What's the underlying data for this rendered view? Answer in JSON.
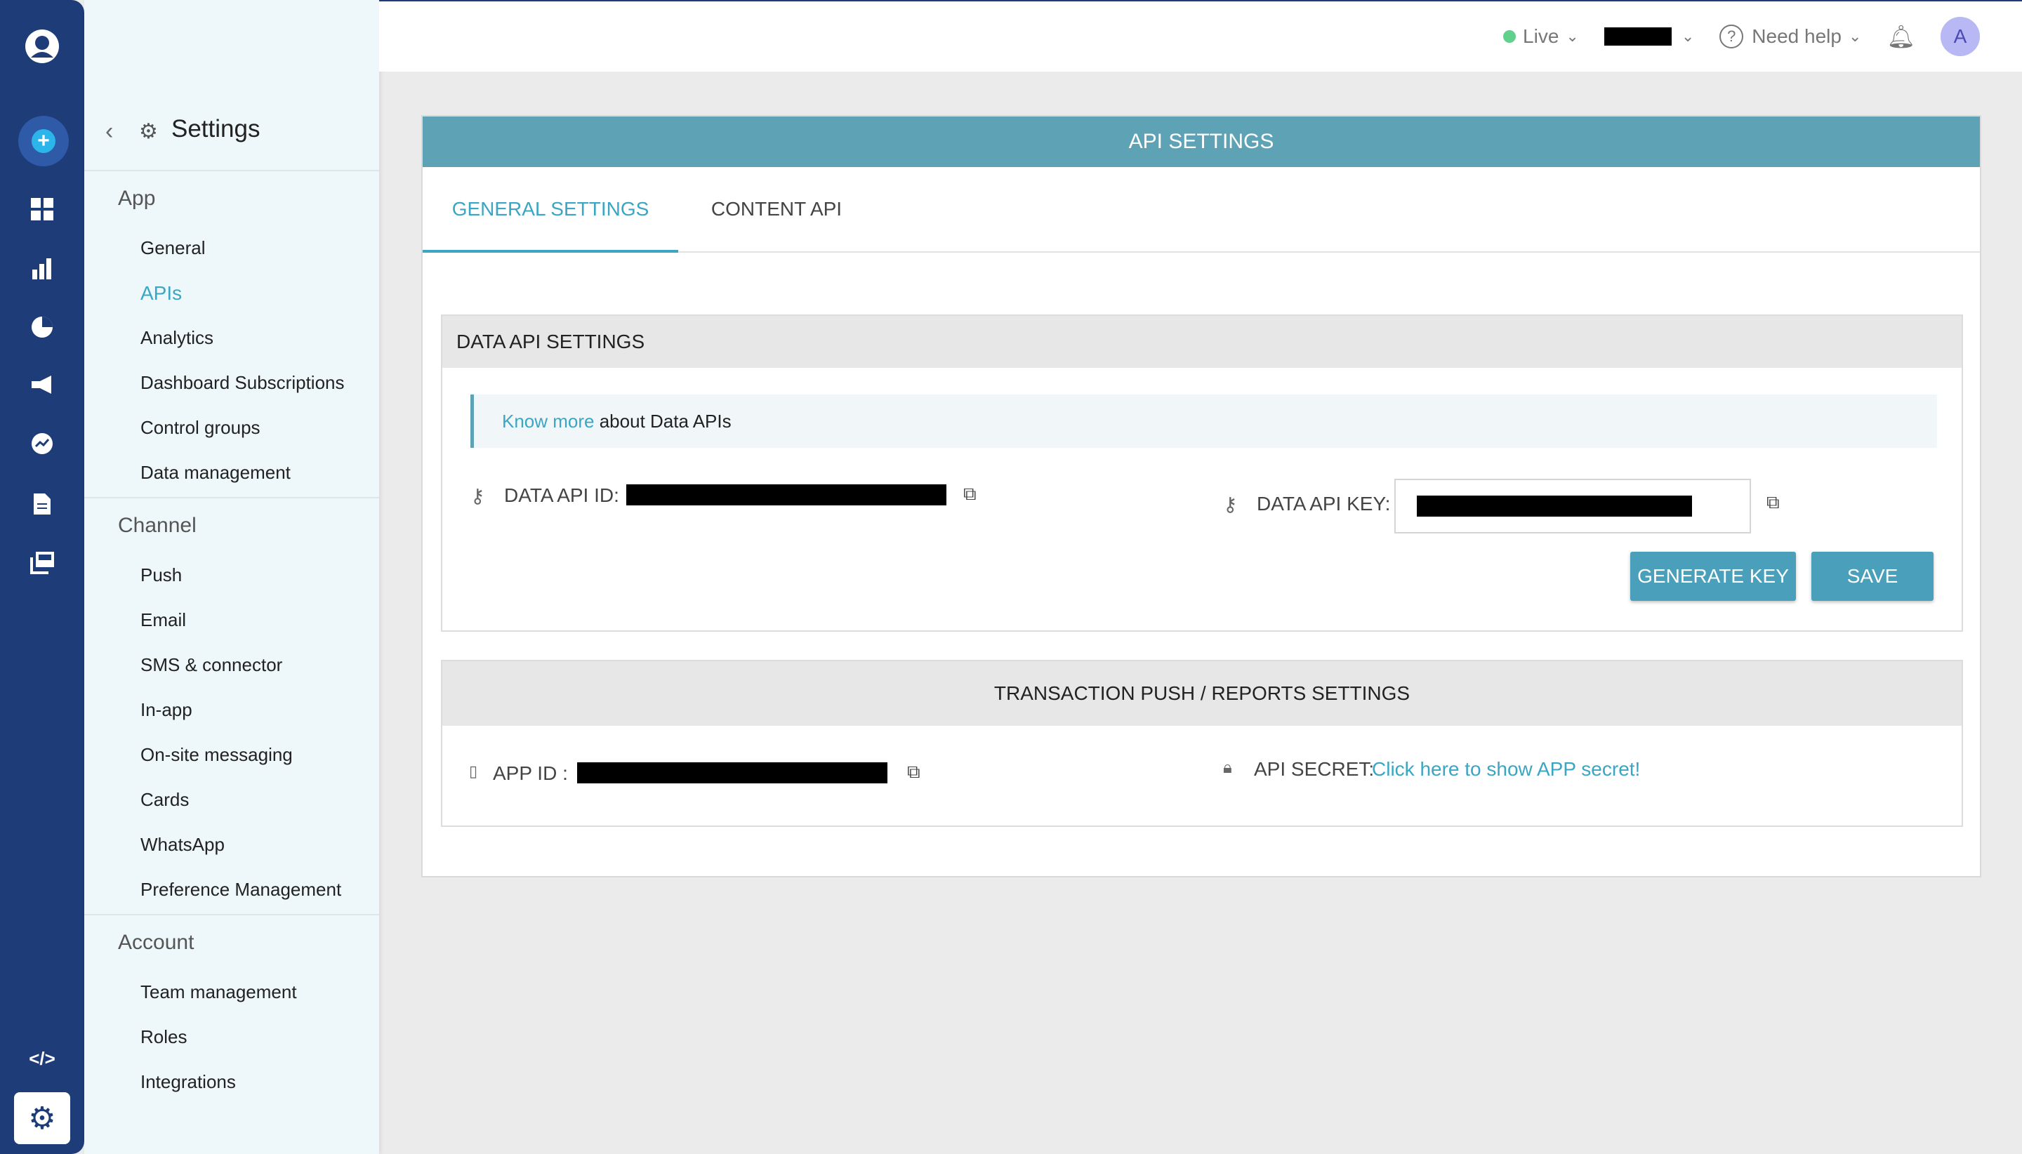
{
  "header": {
    "env_label": "Live",
    "help_label": "Need help",
    "avatar_initial": "A"
  },
  "sidebar": {
    "title": "Settings",
    "sections": [
      {
        "label": "App",
        "items": [
          "General",
          "APIs",
          "Analytics",
          "Dashboard Subscriptions",
          "Control groups",
          "Data management"
        ]
      },
      {
        "label": "Channel",
        "items": [
          "Push",
          "Email",
          "SMS & connector",
          "In-app",
          "On-site messaging",
          "Cards",
          "WhatsApp",
          "Preference Management"
        ]
      },
      {
        "label": "Account",
        "items": [
          "Team management",
          "Roles",
          "Integrations"
        ]
      }
    ],
    "active_item": "APIs"
  },
  "main": {
    "title": "API SETTINGS",
    "tabs": [
      {
        "label": "GENERAL SETTINGS",
        "active": true
      },
      {
        "label": "CONTENT API",
        "active": false
      }
    ],
    "data_api": {
      "heading": "DATA API SETTINGS",
      "info_link": "Know more",
      "info_text": " about Data APIs",
      "id_label": "DATA API ID:",
      "key_label": "DATA API KEY:",
      "generate_label": "GENERATE KEY",
      "save_label": "SAVE"
    },
    "transaction": {
      "heading": "TRANSACTION PUSH / REPORTS SETTINGS",
      "app_id_label": "APP ID :",
      "secret_label": "API SECRET:",
      "secret_link": "Click here to show APP secret!"
    }
  },
  "colors": {
    "rail": "#1d3c78",
    "accent": "#3aa6c3",
    "header_teal": "#5ea3b5"
  }
}
